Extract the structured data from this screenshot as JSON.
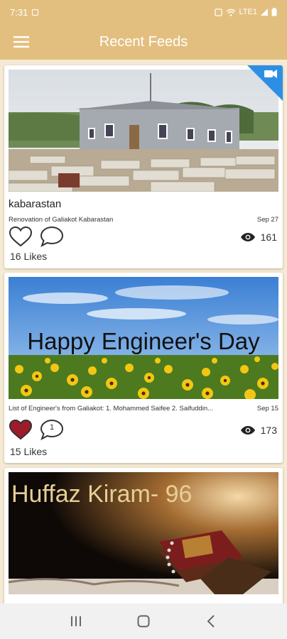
{
  "status": {
    "time": "7:31",
    "network": "LTE1"
  },
  "app_bar": {
    "title": "Recent Feeds"
  },
  "feeds": [
    {
      "title": "kabarastan",
      "description": "Renovation of Galiakot Kabarastan",
      "date": "Sep 27",
      "views": "161",
      "likes": "16 Likes",
      "liked": false,
      "comments": "",
      "video": true
    },
    {
      "title": "",
      "image_text": "Happy Engineer's Day",
      "description": "List of Engineer's from Galiakot:    1. Mohammed Saifee    2. Saifuddin...",
      "date": "Sep 15",
      "views": "173",
      "likes": "15 Likes",
      "liked": true,
      "comments": "1",
      "video": false
    },
    {
      "image_text": "Huffaz Kiram- 96"
    }
  ],
  "colors": {
    "accent": "#e3bf7f",
    "liked": "#9e1b2a"
  }
}
